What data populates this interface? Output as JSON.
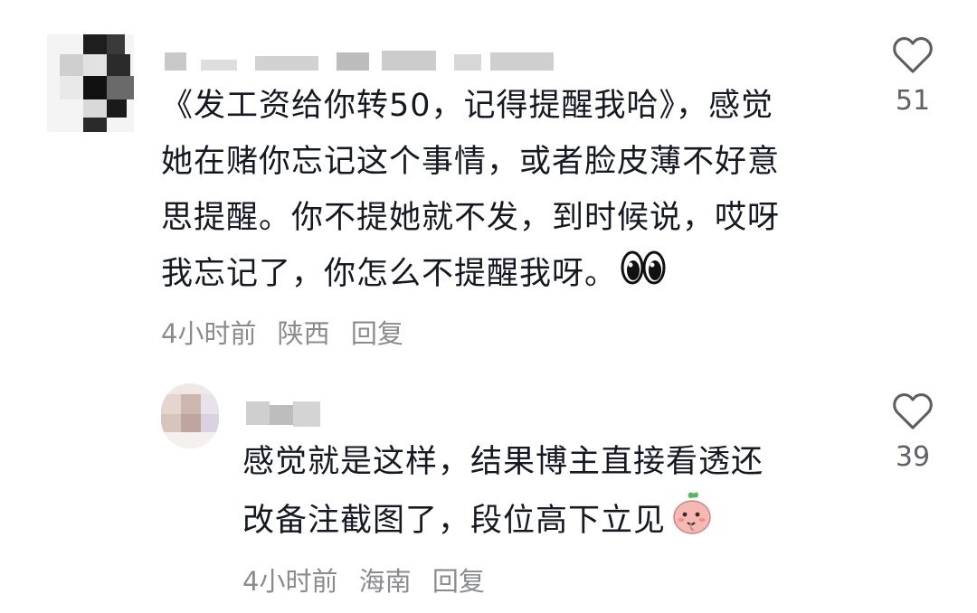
{
  "comments": [
    {
      "text_lines": [
        "《发工资给你转50，记得提醒我哈》，感觉",
        "她在赌你忘记这个事情，或者脸皮薄不好意",
        "思提醒。你不提她就不发，到时候说，哎呀",
        "我忘记了，你怎么不提醒我呀。"
      ],
      "emoji": "eyes-emoji",
      "time": "4小时前",
      "location": "陕西",
      "reply_label": "回复",
      "like_count": "51"
    },
    {
      "text_lines": [
        "感觉就是这样，结果博主直接看透还",
        "改备注截图了，段位高下立见"
      ],
      "emoji": "peach-emoji",
      "time": "4小时前",
      "location": "海南",
      "reply_label": "回复",
      "like_count": "39"
    }
  ]
}
